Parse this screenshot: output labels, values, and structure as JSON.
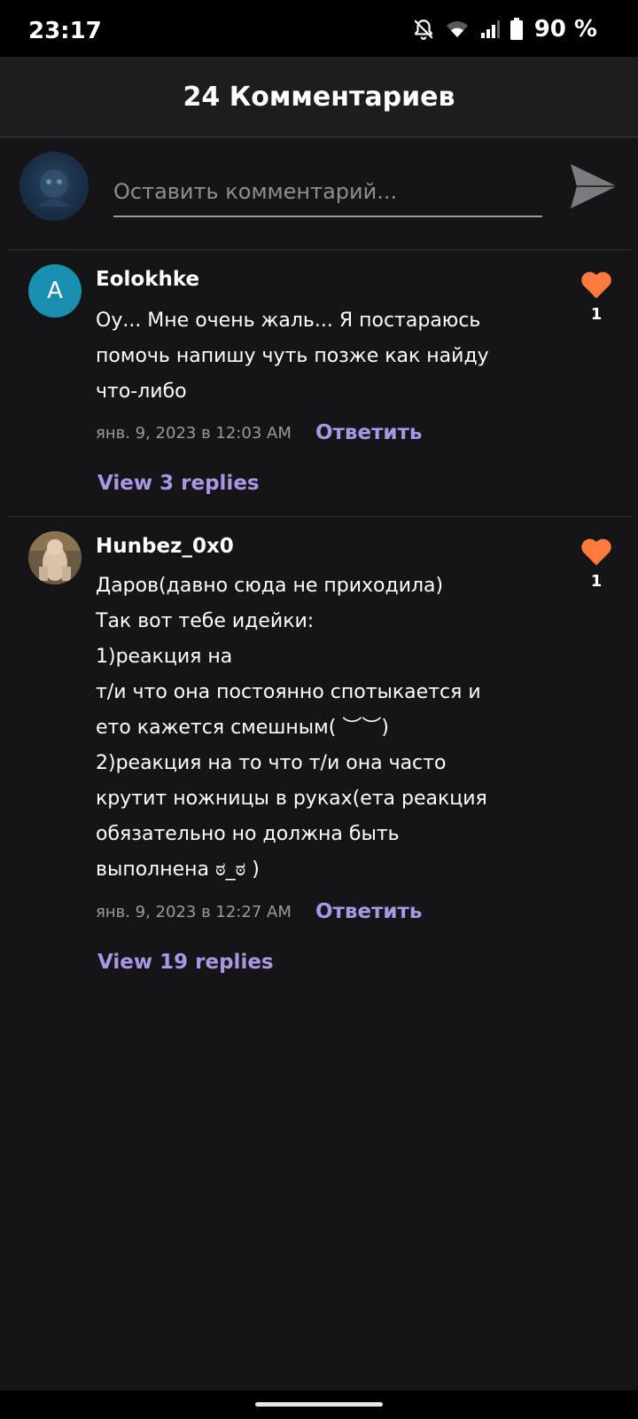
{
  "status_bar": {
    "time": "23:17",
    "battery": "90 %",
    "icons": [
      "notifications-off-icon",
      "wifi-icon",
      "signal-icon",
      "battery-icon"
    ]
  },
  "header": {
    "title": "24 Комментариев"
  },
  "composer": {
    "placeholder": "Оставить комментарий...",
    "value": ""
  },
  "comments": [
    {
      "author": "Eolokhke",
      "avatar_letter": "A",
      "lines": [
        "Оу... Мне очень жаль... Я постараюсь",
        "помочь напишу чуть позже как найду",
        "что-либо"
      ],
      "date": "янв. 9, 2023 в 12:03 AM",
      "reply_label": "Ответить",
      "view_replies": "View 3 replies",
      "likes": "1"
    },
    {
      "author": "Hunbez_0x0",
      "lines": [
        "Даров(давно сюда не приходила)",
        "Так вот тебе идейки:",
        "1)реакция на",
        "т/и что она постоянно спотыкается и",
        "ето кажется смешным( ︶︶)",
        "2)реакция на то что т/и она часто",
        "крутит ножницы в руках(ета реакция",
        "обязательно но должна быть",
        "выполнена ಠ_ಠ )"
      ],
      "date": "янв. 9, 2023 в 12:27 AM",
      "reply_label": "Ответить",
      "view_replies": "View 19 replies",
      "likes": "1"
    }
  ],
  "colors": {
    "background": "#151417",
    "accent": "#a997e6",
    "heart": "#ff7a3d",
    "avatar_letter_bg": "#1b8fb0"
  }
}
